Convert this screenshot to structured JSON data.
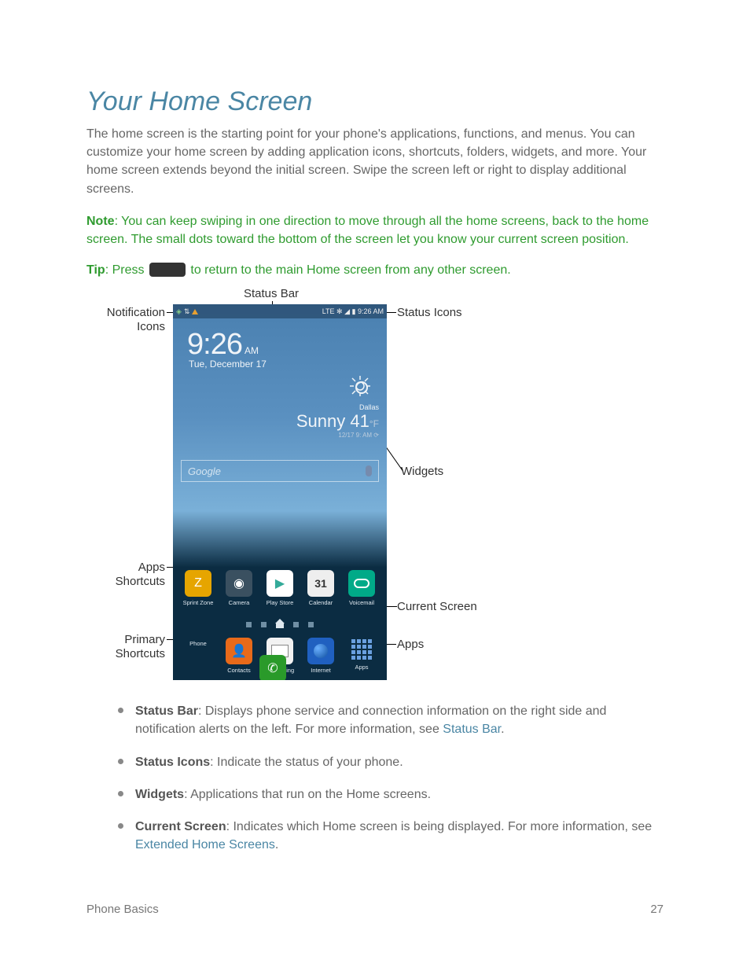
{
  "heading": "Your Home Screen",
  "intro": "The home screen is the starting point for your phone's applications, functions, and menus. You can customize your home screen by adding application icons, shortcuts, folders, widgets, and more. Your home screen extends beyond the initial screen. Swipe the screen left or right to display additional screens.",
  "note": {
    "label": "Note",
    "text": ": You can keep swiping in one direction to move through all the home screens, back to the home screen. The small dots toward the bottom of the screen let you know your current screen position."
  },
  "tip": {
    "label": "Tip",
    "before": ": Press ",
    "after": " to return to the main Home screen from any other screen."
  },
  "diagram": {
    "labels": {
      "statusbar": "Status Bar",
      "notif": "Notification Icons",
      "status_icons": "Status Icons",
      "widgets": "Widgets",
      "apps_shortcuts": "Apps Shortcuts",
      "current_screen": "Current Screen",
      "primary_shortcuts": "Primary Shortcuts",
      "apps": "Apps"
    },
    "phone": {
      "status_right": "LTE ✻ ◢ ▮ 9:26 AM",
      "clock_time": "9:26",
      "clock_ampm": "AM",
      "clock_date": "Tue, December 17",
      "weather_loc": "Dallas",
      "weather_cond": "Sunny ",
      "weather_temp": "41",
      "weather_unit": "°F",
      "weather_upd": "12/17 9:  AM ⟳",
      "google": "Google",
      "cal_day": "31",
      "approw": [
        "Sprint Zone",
        "Camera",
        "Play Store",
        "Calendar",
        "Voicemail"
      ],
      "dock": [
        "Phone",
        "Contacts",
        "Messaging",
        "Internet",
        "Apps"
      ]
    }
  },
  "bullets": [
    {
      "title": "Status Bar",
      "text": ": Displays phone service and connection information on the right side and notification alerts on the left. For more information, see ",
      "link": "Status Bar",
      "after_link": "."
    },
    {
      "title": "Status Icons",
      "text": ": Indicate the status of your phone."
    },
    {
      "title": "Widgets",
      "text": ": Applications that run on the Home screens."
    },
    {
      "title": "Current Screen",
      "text": ": Indicates which Home screen is being displayed. For more information, see ",
      "link": "Extended Home Screens",
      "after_link": "."
    }
  ],
  "footer": {
    "section": "Phone Basics",
    "page": "27"
  }
}
